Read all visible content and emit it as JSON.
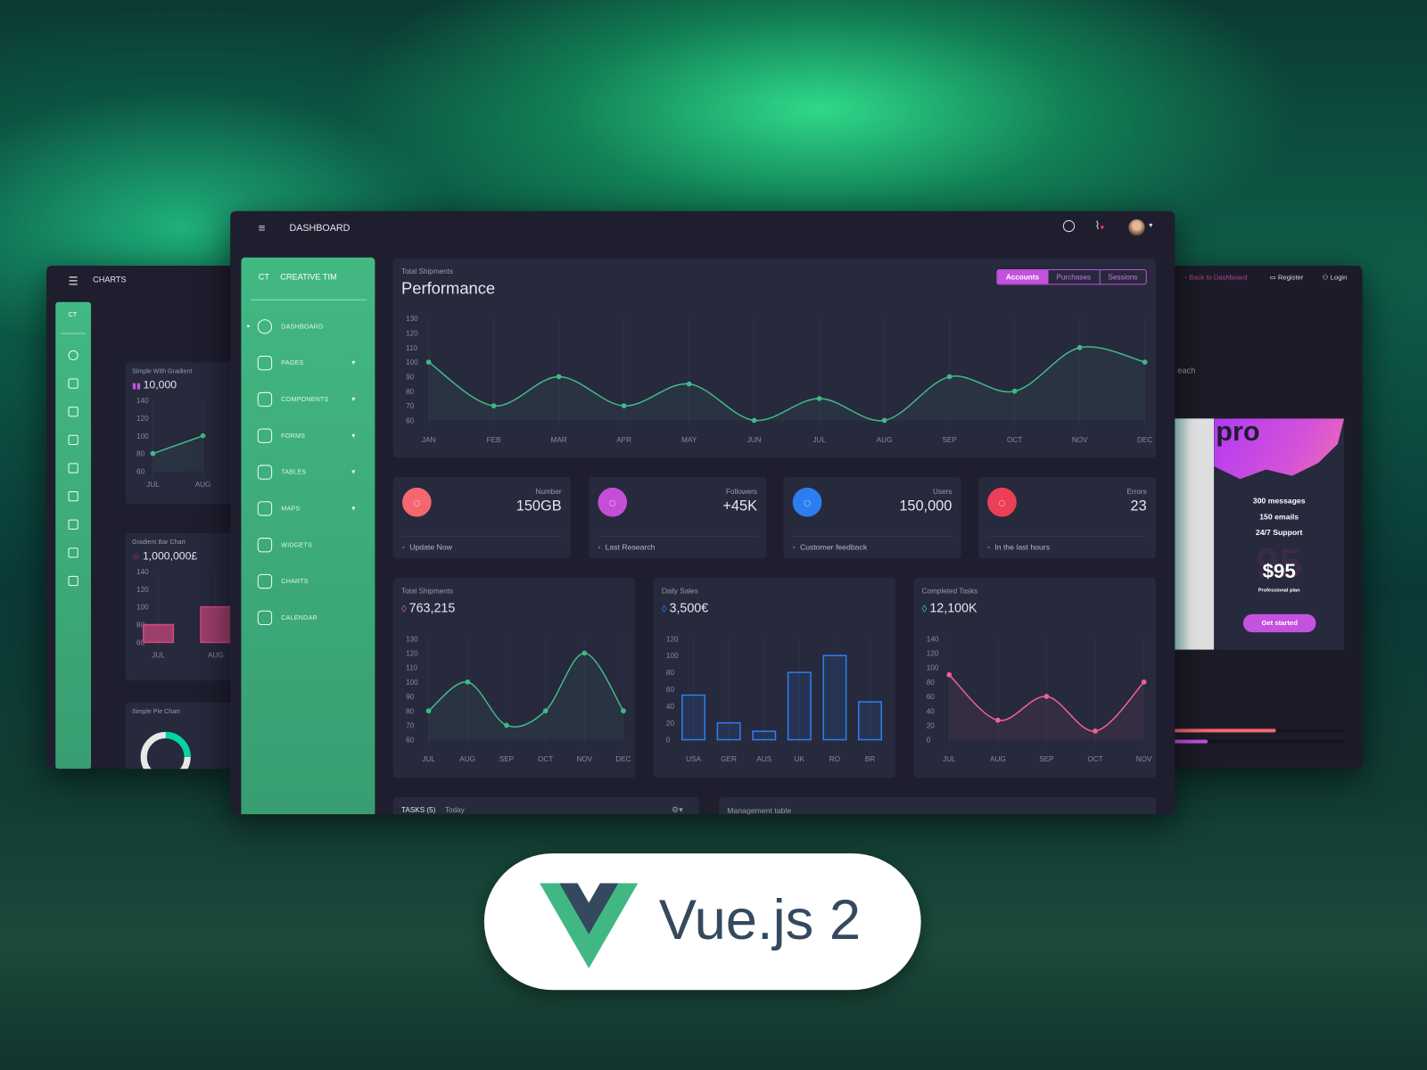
{
  "main_window": {
    "header_title": "DASHBOARD",
    "sidebar": {
      "brand_short": "CT",
      "brand": "CREATIVE TIM",
      "items": [
        {
          "label": "DASHBOARD",
          "icon": "chart-pie-icon",
          "active": true,
          "expandable": false
        },
        {
          "label": "PAGES",
          "icon": "image-icon",
          "expandable": true
        },
        {
          "label": "COMPONENTS",
          "icon": "atom-icon",
          "expandable": true
        },
        {
          "label": "FORMS",
          "icon": "clipboard-icon",
          "expandable": true
        },
        {
          "label": "TABLES",
          "icon": "puzzle-icon",
          "expandable": true
        },
        {
          "label": "MAPS",
          "icon": "pin-icon",
          "expandable": true
        },
        {
          "label": "WIDGETS",
          "icon": "tools-icon",
          "expandable": false
        },
        {
          "label": "CHARTS",
          "icon": "bar-chart-icon",
          "expandable": false
        },
        {
          "label": "CALENDAR",
          "icon": "alarm-clock-icon",
          "expandable": false
        }
      ]
    },
    "performance": {
      "subtitle": "Total Shipments",
      "title": "Performance",
      "tabs": [
        "Accounts",
        "Purchases",
        "Sessions"
      ],
      "active_tab": "Accounts"
    },
    "stats": [
      {
        "label": "Number",
        "value": "150GB",
        "footer": "Update Now",
        "icon": "chat-icon",
        "footer_icon": "refresh-icon",
        "color": "#f5676f"
      },
      {
        "label": "Followers",
        "value": "+45K",
        "footer": "Last Research",
        "icon": "star-icon",
        "footer_icon": "pulse-icon",
        "color": "#c44fd6"
      },
      {
        "label": "Users",
        "value": "150,000",
        "footer": "Customer feedback",
        "icon": "user-icon",
        "footer_icon": "trophy-icon",
        "color": "#2c7ef0"
      },
      {
        "label": "Errors",
        "value": "23",
        "footer": "In the last hours",
        "icon": "molecule-icon",
        "footer_icon": "watch-icon",
        "color": "#ec3e55"
      }
    ],
    "small_charts": [
      {
        "subtitle": "Total Shipments",
        "value": "763,215",
        "icon": "bell-icon",
        "icon_color": "#d05bd6"
      },
      {
        "subtitle": "Daily Sales",
        "value": "3,500€",
        "icon": "delivery-icon",
        "icon_color": "#2c7ef0"
      },
      {
        "subtitle": "Completed Tasks",
        "value": "12,100K",
        "icon": "send-icon",
        "icon_color": "#2fd4a2"
      }
    ],
    "tasks": {
      "title": "TASKS (5)",
      "subtitle": "Today"
    },
    "management": {
      "title": "Management table"
    }
  },
  "left_window": {
    "header_title": "CHARTS",
    "brand_short": "CT",
    "cards": [
      {
        "subtitle": "Simple With Gradient",
        "value": "10,000"
      },
      {
        "subtitle": "Gradient Bar Chart",
        "value": "1,000,000£"
      },
      {
        "subtitle": "Simple Pie Chart"
      }
    ]
  },
  "right_window": {
    "nav": {
      "back": "Back to Dashboard",
      "register": "Register",
      "login": "Login"
    },
    "partial_text": "each",
    "pricing": {
      "title": "pro",
      "features": [
        "300 messages",
        "150 emails",
        "24/7 Support"
      ],
      "price": "$95",
      "price_bg": "95",
      "plan": "Professional plan",
      "cta": "Get started"
    },
    "progress": [
      {
        "value": 0.6,
        "color": "#f5676f"
      },
      {
        "value": 0.2,
        "color": "#c452e0"
      }
    ]
  },
  "badge": {
    "text": "Vue.js 2"
  },
  "colors": {
    "accent_green": "#42b883",
    "accent_pink": "#c452e0",
    "panel": "#27293d",
    "bg": "#1e1e2f"
  },
  "chart_data": [
    {
      "type": "line",
      "title": "Performance",
      "categories": [
        "JAN",
        "FEB",
        "MAR",
        "APR",
        "MAY",
        "JUN",
        "JUL",
        "AUG",
        "SEP",
        "OCT",
        "NOV",
        "DEC"
      ],
      "values": [
        100,
        70,
        90,
        70,
        85,
        60,
        75,
        60,
        90,
        80,
        110,
        100
      ],
      "yticks": [
        130,
        120,
        110,
        100,
        90,
        80,
        70,
        60
      ],
      "ylim": [
        60,
        130
      ],
      "color": "#42b883"
    },
    {
      "type": "line",
      "title": "Total Shipments",
      "categories": [
        "JUL",
        "AUG",
        "SEP",
        "OCT",
        "NOV",
        "DEC"
      ],
      "values": [
        80,
        100,
        70,
        80,
        120,
        80
      ],
      "yticks": [
        130,
        120,
        110,
        100,
        90,
        80,
        70,
        60
      ],
      "ylim": [
        60,
        130
      ],
      "color": "#42b883"
    },
    {
      "type": "bar",
      "title": "Daily Sales",
      "categories": [
        "USA",
        "GER",
        "AUS",
        "UK",
        "RO",
        "BR"
      ],
      "values": [
        53,
        20,
        10,
        80,
        100,
        45
      ],
      "yticks": [
        120,
        100,
        80,
        60,
        40,
        20,
        0
      ],
      "ylim": [
        0,
        120
      ],
      "color": "#2c7ef0"
    },
    {
      "type": "line",
      "title": "Completed Tasks",
      "categories": [
        "JUL",
        "AUG",
        "SEP",
        "OCT",
        "NOV"
      ],
      "values": [
        90,
        27,
        60,
        12,
        80
      ],
      "yticks": [
        140,
        120,
        100,
        80,
        60,
        40,
        20,
        0
      ],
      "ylim": [
        0,
        140
      ],
      "color": "#f06292"
    },
    {
      "type": "line",
      "title": "Simple With Gradient",
      "categories": [
        "JUL",
        "AUG"
      ],
      "values": [
        80,
        100
      ],
      "yticks": [
        140,
        120,
        100,
        80,
        60
      ],
      "ylim": [
        60,
        140
      ],
      "color": "#42b883"
    },
    {
      "type": "bar",
      "title": "Gradient Bar Chart",
      "categories": [
        "JUL",
        "AUG"
      ],
      "values": [
        80,
        100
      ],
      "yticks": [
        140,
        120,
        100,
        80,
        60
      ],
      "ylim": [
        60,
        140
      ],
      "color": "#d0487f"
    }
  ]
}
